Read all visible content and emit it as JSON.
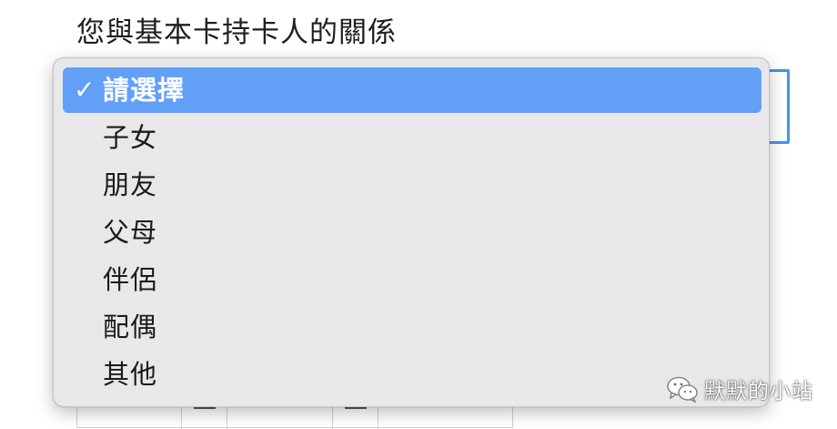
{
  "form": {
    "relationship_label": "您與基本卡持卡人的關係"
  },
  "dropdown": {
    "check_glyph": "✓",
    "options": [
      {
        "label": "請選擇",
        "selected": true
      },
      {
        "label": "子女",
        "selected": false
      },
      {
        "label": "朋友",
        "selected": false
      },
      {
        "label": "父母",
        "selected": false
      },
      {
        "label": "伴侶",
        "selected": false
      },
      {
        "label": "配偶",
        "selected": false
      },
      {
        "label": "其他",
        "selected": false
      }
    ]
  },
  "watermark": {
    "text": "默默的小站",
    "icon": "wechat-icon"
  },
  "colors": {
    "selected_highlight": "#62a0f8",
    "focus_border": "#4d90ea",
    "menu_background": "#e8e8ea"
  }
}
